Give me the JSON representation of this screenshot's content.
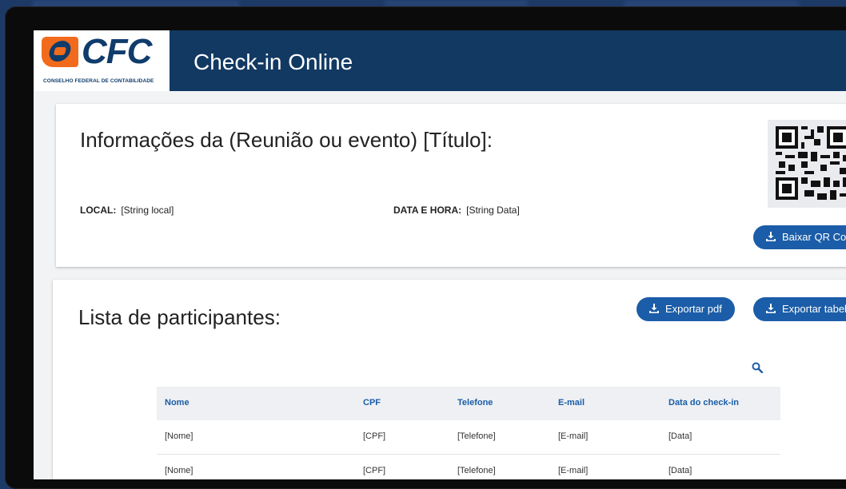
{
  "header": {
    "logo_text": "CFC",
    "logo_subtitle": "CONSELHO FEDERAL DE CONTABILIDADE",
    "app_title": "Check-in Online"
  },
  "event": {
    "title": "Informações da (Reunião ou evento) [Título]:",
    "local_label": "LOCAL:",
    "local_value": "[String local]",
    "datetime_label": "DATA E HORA:",
    "datetime_value": "[String Data]",
    "download_qr_label": "Baixar QR Code"
  },
  "participants": {
    "title": "Lista de participantes:",
    "export_pdf_label": "Exportar pdf",
    "export_table_label": "Exportar tabela",
    "columns": [
      "Nome",
      "CPF",
      "Telefone",
      "E-mail",
      "Data do check-in"
    ],
    "rows": [
      [
        "[Nome]",
        "[CPF]",
        "[Telefone]",
        "[E-mail]",
        "[Data]"
      ],
      [
        "[Nome]",
        "[CPF]",
        "[Telefone]",
        "[E-mail]",
        "[Data]"
      ]
    ]
  },
  "icons": {
    "download": "download-icon",
    "search": "search-icon",
    "qr": "qr-code-icon"
  },
  "colors": {
    "header_bg": "#123962",
    "accent": "#1b5da8",
    "logo_orange": "#f26a1b"
  }
}
